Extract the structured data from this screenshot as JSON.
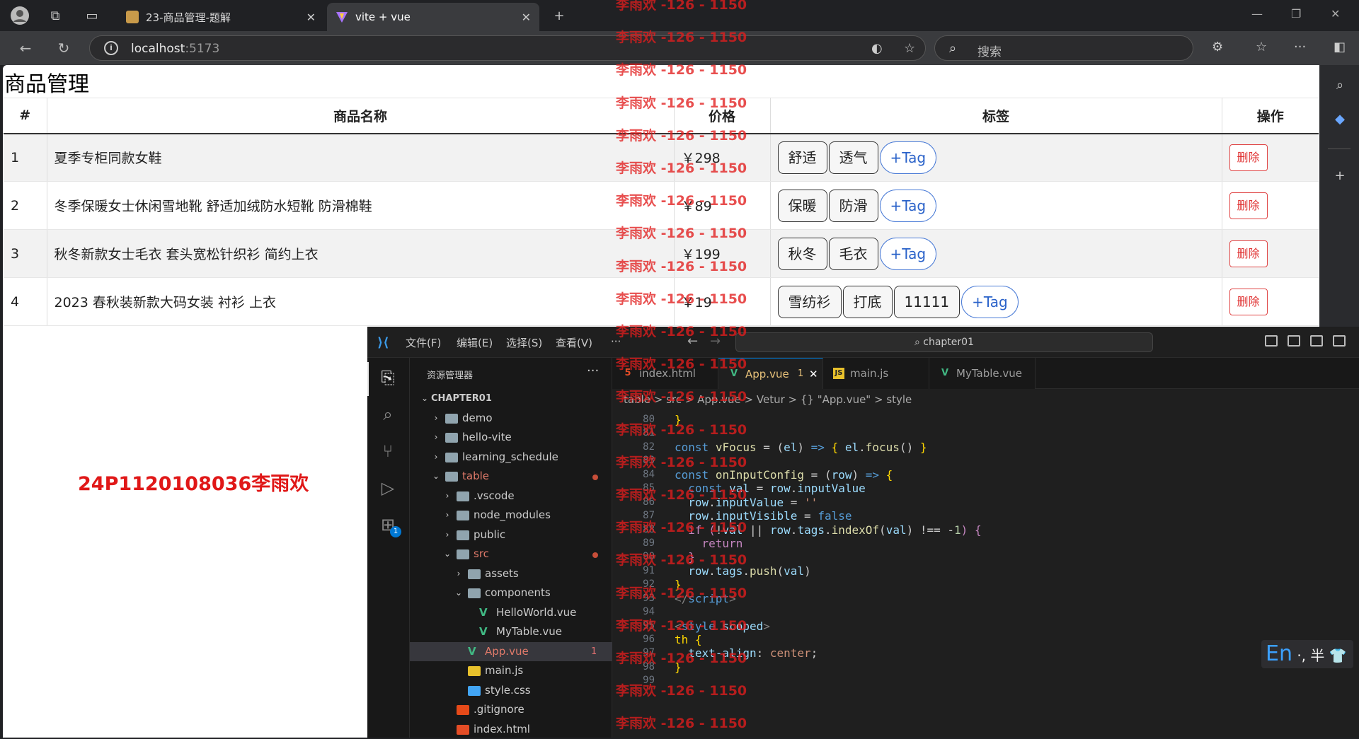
{
  "browser": {
    "tabs": [
      {
        "title": "23-商品管理-题解"
      },
      {
        "title": "vite + vue"
      }
    ],
    "url_host": "localhost",
    "url_port": ":5173",
    "search_placeholder": "搜索"
  },
  "page": {
    "title": "商品管理",
    "columns": [
      "#",
      "商品名称",
      "价格",
      "标签",
      "操作"
    ],
    "rows": [
      {
        "id": "1",
        "name": "夏季专柜同款女鞋",
        "price": "￥298",
        "tags": [
          "舒适",
          "透气"
        ]
      },
      {
        "id": "2",
        "name": "冬季保暖女士休闲雪地靴 舒适加绒防水短靴 防滑棉鞋",
        "price": "￥89",
        "tags": [
          "保暖",
          "防滑"
        ]
      },
      {
        "id": "3",
        "name": "秋冬新款女士毛衣 套头宽松针织衫 简约上衣",
        "price": "￥199",
        "tags": [
          "秋冬",
          "毛衣"
        ]
      },
      {
        "id": "4",
        "name": "2023 春秋装新款大码女装 衬衫 上衣",
        "price": "￥19",
        "tags": [
          "雪纺衫",
          "打底",
          "11111"
        ]
      }
    ],
    "add_tag_label": "+Tag",
    "delete_label": "删除",
    "student_label": "24P1120108036李雨欢"
  },
  "watermark": "李雨欢 -126 - 1150",
  "vscode": {
    "menu": [
      "文件(F)",
      "编辑(E)",
      "选择(S)",
      "查看(V)",
      "···"
    ],
    "command_center": "chapter01",
    "explorer_title": "资源管理器",
    "explorer_more": "···",
    "badge": "1",
    "tree": [
      {
        "label": "CHAPTER01",
        "depth": 0,
        "type": "root",
        "open": true
      },
      {
        "label": "demo",
        "depth": 1,
        "type": "folder"
      },
      {
        "label": "hello-vite",
        "depth": 1,
        "type": "folder"
      },
      {
        "label": "learning_schedule",
        "depth": 1,
        "type": "folder"
      },
      {
        "label": "table",
        "depth": 1,
        "type": "folder",
        "open": true,
        "modified": true
      },
      {
        "label": ".vscode",
        "depth": 2,
        "type": "folder"
      },
      {
        "label": "node_modules",
        "depth": 2,
        "type": "folder"
      },
      {
        "label": "public",
        "depth": 2,
        "type": "folder"
      },
      {
        "label": "src",
        "depth": 2,
        "type": "folder",
        "open": true,
        "modified": true
      },
      {
        "label": "assets",
        "depth": 3,
        "type": "folder"
      },
      {
        "label": "components",
        "depth": 3,
        "type": "folder",
        "open": true
      },
      {
        "label": "HelloWorld.vue",
        "depth": 4,
        "type": "vue"
      },
      {
        "label": "MyTable.vue",
        "depth": 4,
        "type": "vue"
      },
      {
        "label": "App.vue",
        "depth": 3,
        "type": "vue",
        "selected": true,
        "problems": "1"
      },
      {
        "label": "main.js",
        "depth": 3,
        "type": "js"
      },
      {
        "label": "style.css",
        "depth": 3,
        "type": "css"
      },
      {
        "label": ".gitignore",
        "depth": 2,
        "type": "git"
      },
      {
        "label": "index.html",
        "depth": 2,
        "type": "html"
      }
    ],
    "editor_tabs": [
      {
        "label": "index.html",
        "type": "html"
      },
      {
        "label": "App.vue",
        "type": "vue",
        "active": true,
        "problems": "1"
      },
      {
        "label": "main.js",
        "type": "js"
      },
      {
        "label": "MyTable.vue",
        "type": "vue"
      }
    ],
    "breadcrumb": "table > src > App.vue > Vetur > {} \"App.vue\" > style",
    "code_lines": [
      {
        "no": "80",
        "html": "<span class='y'>}</span>"
      },
      {
        "no": "81",
        "html": ""
      },
      {
        "no": "82",
        "html": "<span class='k'>const</span> <span class='f'>vFocus</span> = (<span class='v'>el</span>) <span class='k'>=&gt;</span> <span class='y'>{</span> <span class='v'>el</span>.<span class='f'>focus</span>() <span class='y'>}</span>"
      },
      {
        "no": "83",
        "html": ""
      },
      {
        "no": "84",
        "html": "<span class='k'>const</span> <span class='f'>onInputConfig</span> = (<span class='v'>row</span>) <span class='k'>=&gt;</span> <span class='y'>{</span>"
      },
      {
        "no": "85",
        "html": "  <span class='k'>const</span> <span class='v'>val</span> = <span class='v'>row</span>.<span class='v'>inputValue</span>"
      },
      {
        "no": "86",
        "html": "  <span class='v'>row</span>.<span class='v'>inputValue</span> = <span class='s'>''</span>"
      },
      {
        "no": "87",
        "html": "  <span class='v'>row</span>.<span class='v'>inputVisible</span> = <span class='k'>false</span>"
      },
      {
        "no": "88",
        "html": "  <span class='p'>if</span> <span class='p'>(</span>!<span class='v'>val</span> || <span class='v'>row</span>.<span class='v'>tags</span>.<span class='f'>indexOf</span>(<span class='v'>val</span>) !== -<span class='n'>1</span><span class='p'>)</span> <span class='p'>{</span>"
      },
      {
        "no": "89",
        "html": "    <span class='p'>return</span>"
      },
      {
        "no": "90",
        "html": "  <span class='p'>}</span>"
      },
      {
        "no": "91",
        "html": "  <span class='v'>row</span>.<span class='v'>tags</span>.<span class='f'>push</span>(<span class='v'>val</span>)"
      },
      {
        "no": "92",
        "html": "<span class='y'>}</span>"
      },
      {
        "no": "93",
        "html": "<span class='g'>&lt;/</span><span class='t'>script</span><span class='g'>&gt;</span>"
      },
      {
        "no": "94",
        "html": ""
      },
      {
        "no": "95",
        "html": "<span class='g'>&lt;</span><span class='t'>style</span> <span class='pr'>scoped</span><span class='g'>&gt;</span>"
      },
      {
        "no": "96",
        "html": "<span class='y'>th {</span>"
      },
      {
        "no": "97",
        "html": "  <span class='pr'>text-align</span>: <span class='s'>center</span>;"
      },
      {
        "no": "98",
        "html": "<span class='y'>}</span>"
      },
      {
        "no": "99",
        "html": ""
      }
    ]
  },
  "ime": {
    "lang": "En",
    "rest": "·, 半"
  },
  "colors": {
    "accent": "#0078d4",
    "watermark": "#e11e1e",
    "danger": "#e03333",
    "tag_add": "#2a62c9"
  }
}
